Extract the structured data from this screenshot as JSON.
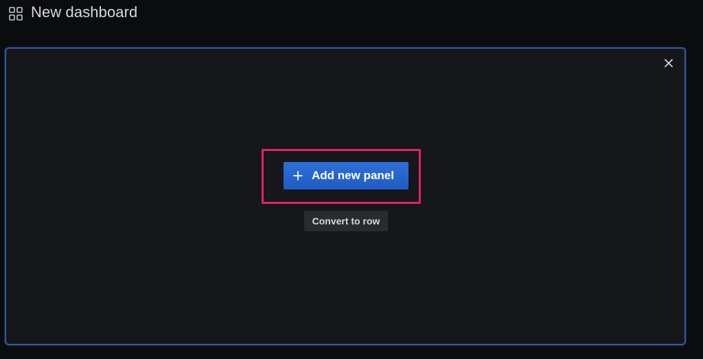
{
  "dashboard": {
    "title": "New dashboard",
    "icon": "grid-icon"
  },
  "panel": {
    "close_icon": "close-icon",
    "add_button": {
      "label": "Add new panel",
      "icon": "plus-icon",
      "color": "#2f6fd6"
    },
    "convert_button": {
      "label": "Convert to row"
    },
    "highlight_color": "#e4245c",
    "border_color": "#2f5aa8"
  }
}
